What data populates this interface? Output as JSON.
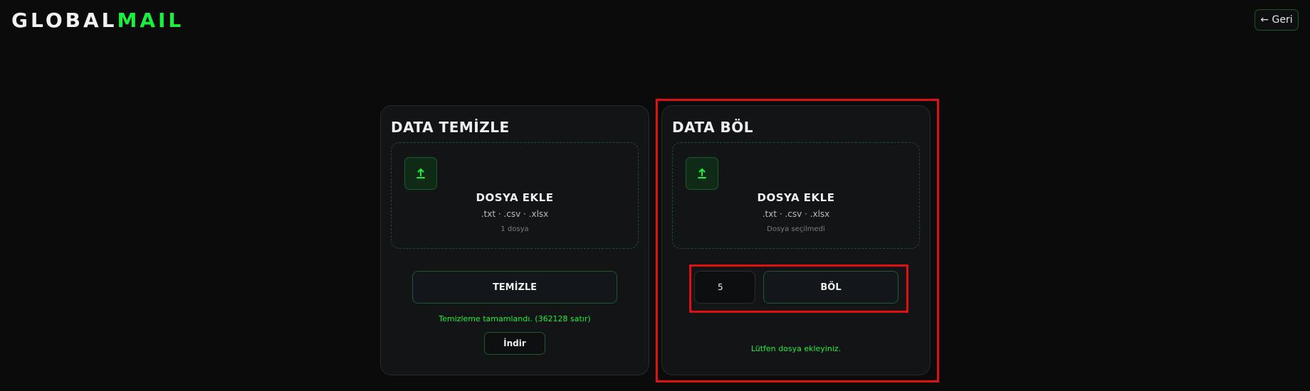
{
  "app": {
    "logo_part1": "GLOBAL",
    "logo_part2": "MAIL",
    "back_label": "← Geri"
  },
  "clean_card": {
    "title": "DATA TEMİZLE",
    "dropzone": {
      "icon": "upload-arrow-icon",
      "title": "DOSYA EKLE",
      "types": ".txt · .csv · .xlsx",
      "status": "1 dosya"
    },
    "button_label": "TEMİZLE",
    "message": "Temizleme tamamlandı. (362128 satır)",
    "download_label": "İndir"
  },
  "split_card": {
    "title": "DATA BÖL",
    "dropzone": {
      "icon": "upload-arrow-icon",
      "title": "DOSYA EKLE",
      "types": ".txt · .csv · .xlsx",
      "status": "Dosya seçilmedi"
    },
    "count_value": "5",
    "button_label": "BÖL",
    "message": "Lütfen dosya ekleyiniz."
  },
  "colors": {
    "accent": "#19f03d",
    "background": "#0b0b0c",
    "card": "#121416",
    "highlight": "#e01010"
  }
}
